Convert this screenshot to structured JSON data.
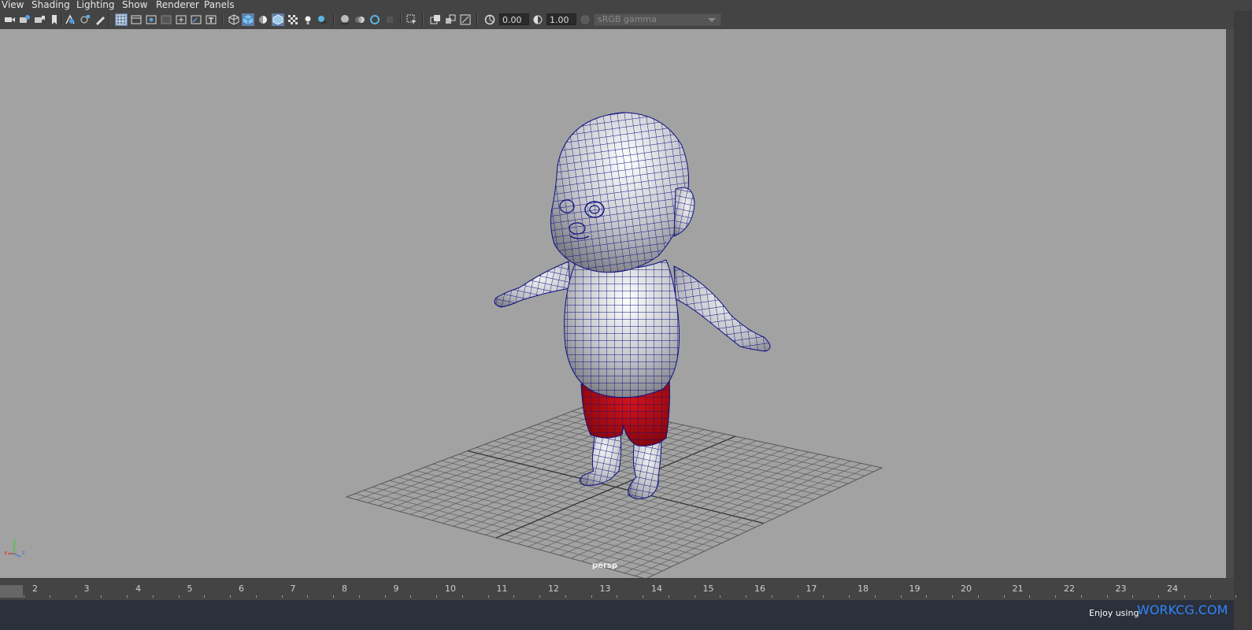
{
  "menubar": {
    "items": [
      "View",
      "Shading",
      "Lighting",
      "Show",
      "Renderer",
      "Panels"
    ]
  },
  "toolbar": {
    "exposure_value": "0.00",
    "gamma_value": "1.00",
    "color_space": "sRGB gamma",
    "icons": [
      "select-camera-icon",
      "camera-attributes-icon",
      "bookmark-icon",
      "image-plane-icon",
      "2d-pan-zoom-icon",
      "grease-pencil-icon",
      "grid-icon",
      "film-gate-icon",
      "resolution-gate-icon",
      "gate-mask-icon",
      "field-chart-icon",
      "safe-action-icon",
      "safe-title-icon",
      "wireframe-icon",
      "smooth-shade-icon",
      "default-lighting-icon",
      "wireframe-on-shaded-icon",
      "textured-icon",
      "use-all-lights-icon",
      "shadows-icon",
      "screen-space-ao-icon",
      "motion-blur-icon",
      "anti-aliasing-icon",
      "depth-of-field-icon",
      "isolate-select-icon",
      "xray-icon",
      "xray-joints-icon",
      "xray-components-icon",
      "exposure-icon",
      "gamma-icon",
      "color-management-icon"
    ]
  },
  "viewport": {
    "camera_label": "persp",
    "axis": {
      "x": "x",
      "y": "y",
      "z": "z"
    }
  },
  "timeline": {
    "frames": [
      "2",
      "3",
      "4",
      "5",
      "6",
      "7",
      "8",
      "9",
      "10",
      "11",
      "12",
      "13",
      "14",
      "15",
      "16",
      "17",
      "18",
      "19",
      "20",
      "21",
      "22",
      "23",
      "24"
    ]
  },
  "statusbar": {
    "enjoy_text": "Enjoy using",
    "brand_text": "WORKCG.COM"
  },
  "colors": {
    "viewport_bg": "#a2a2a2",
    "wire": "#0e1180",
    "shorts": "#b3080f",
    "brand": "#2f86ff"
  }
}
